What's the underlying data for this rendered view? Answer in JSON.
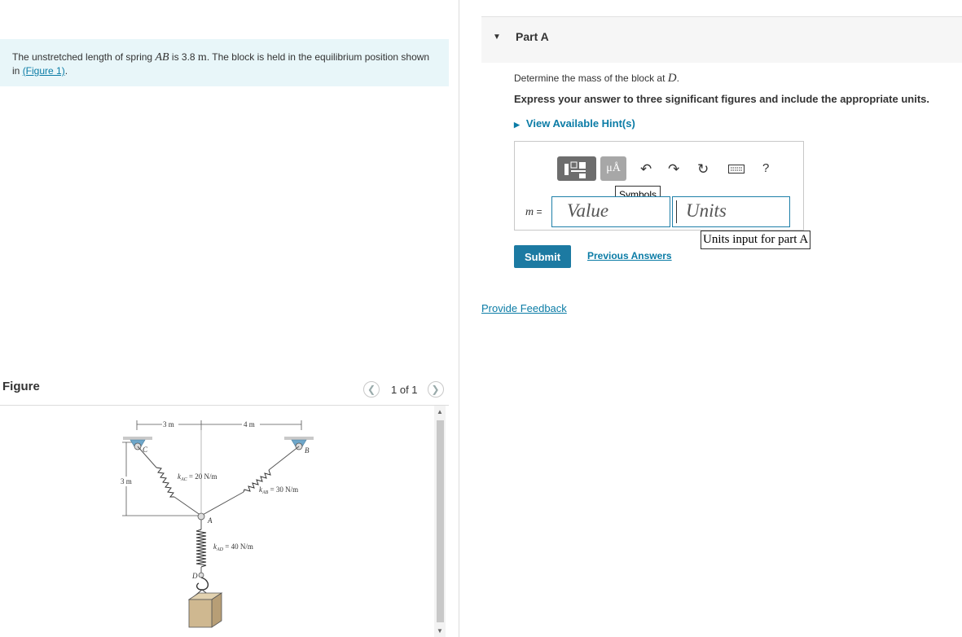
{
  "problem": {
    "text_before": "The unstretched length of spring ",
    "var_ab": "AB",
    "text_mid": " is 3.8 ",
    "unit_m": "m",
    "text_after": ". The block is held in the equilibrium position shown in ",
    "figure_link": "(Figure 1)",
    "period": "."
  },
  "figure": {
    "title": "Figure",
    "pager_text": "1 of 1",
    "dim_3m_top": "3 m",
    "dim_4m_top": "4 m",
    "dim_3m_side": "3 m",
    "label_c": "C",
    "label_b": "B",
    "label_a": "A",
    "label_d": "D",
    "k_ac": "k",
    "k_ac_sub": "AC",
    "k_ac_val": " = 20 N/m",
    "k_ab": "k",
    "k_ab_sub": "AB",
    "k_ab_val": " = 30 N/m",
    "k_ad": "k",
    "k_ad_sub": "AD",
    "k_ad_val": " = 40 N/m"
  },
  "part": {
    "title": "Part A",
    "question_before": "Determine the mass of the block at ",
    "question_var": "D",
    "question_after": ".",
    "instruction": "Express your answer to three significant figures and include the appropriate units.",
    "hint_link": "View Available Hint(s)"
  },
  "answer": {
    "tool_symbols_glyph": "μÅ",
    "symbols_tooltip": "Symbols",
    "var_label": "m",
    "equals": " =",
    "value_placeholder": "Value",
    "units_placeholder": "Units",
    "units_tooltip": "Units input for part A",
    "help_glyph": "?"
  },
  "actions": {
    "submit": "Submit",
    "previous_answers": "Previous Answers",
    "provide_feedback": "Provide Feedback"
  }
}
